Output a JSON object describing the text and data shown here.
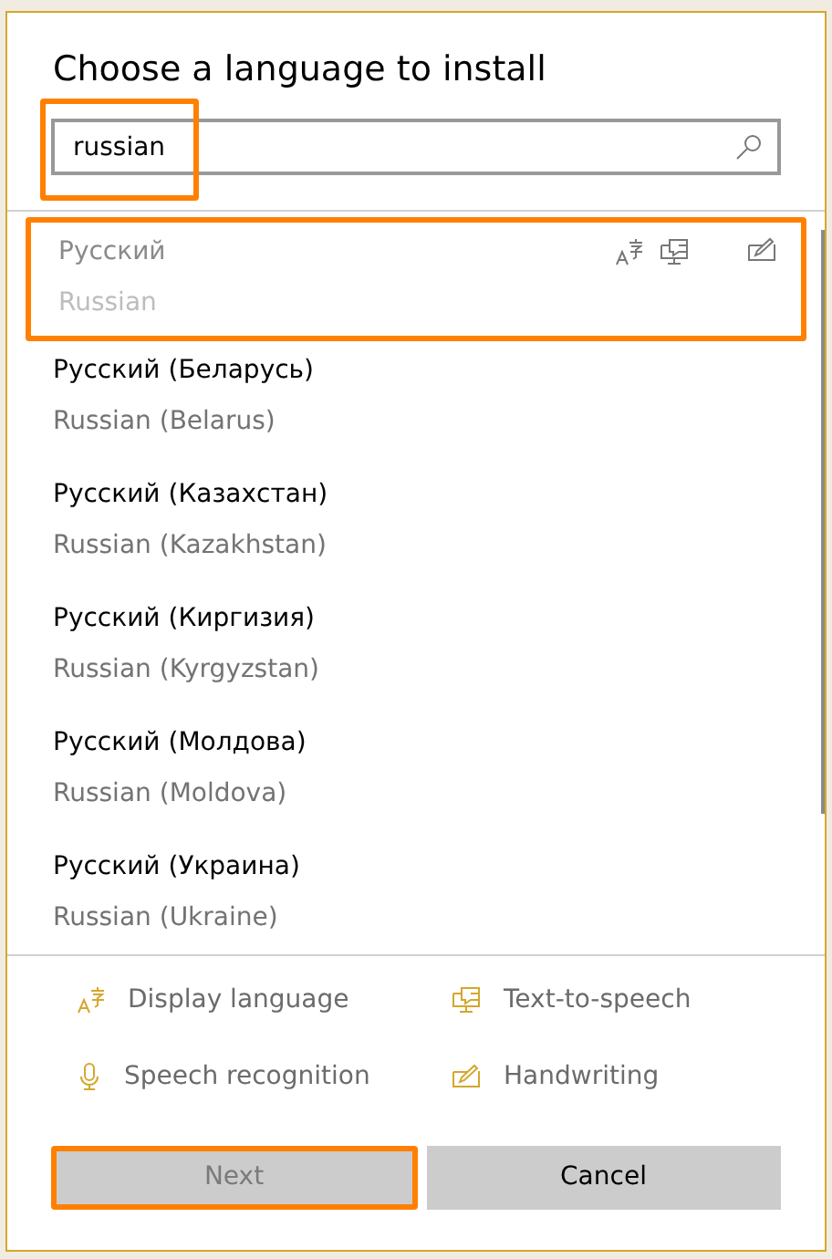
{
  "dialog": {
    "title": "Choose a language to install"
  },
  "search": {
    "value": "russian",
    "highlighted": true
  },
  "languages": [
    {
      "native": "Русский",
      "english": "Russian",
      "disabled": true,
      "highlighted": true,
      "display_language": true,
      "text_to_speech": true,
      "speech_recognition": false,
      "handwriting": true
    },
    {
      "native": "Русский (Беларусь)",
      "english": "Russian (Belarus)",
      "disabled": false,
      "highlighted": false
    },
    {
      "native": "Русский (Казахстан)",
      "english": "Russian (Kazakhstan)",
      "disabled": false,
      "highlighted": false
    },
    {
      "native": "Русский (Киргизия)",
      "english": "Russian (Kyrgyzstan)",
      "disabled": false,
      "highlighted": false
    },
    {
      "native": "Русский (Молдова)",
      "english": "Russian (Moldova)",
      "disabled": false,
      "highlighted": false
    },
    {
      "native": "Русский (Украина)",
      "english": "Russian (Ukraine)",
      "disabled": false,
      "highlighted": false
    }
  ],
  "legend": [
    {
      "kind": "display",
      "label": "Display language"
    },
    {
      "kind": "speech",
      "label": "Text-to-speech"
    },
    {
      "kind": "mic",
      "label": "Speech recognition"
    },
    {
      "kind": "handwriting",
      "label": "Handwriting"
    }
  ],
  "buttons": [
    {
      "label": "Next",
      "disabled": true,
      "highlighted": true
    },
    {
      "label": "Cancel",
      "disabled": false,
      "highlighted": false
    }
  ]
}
